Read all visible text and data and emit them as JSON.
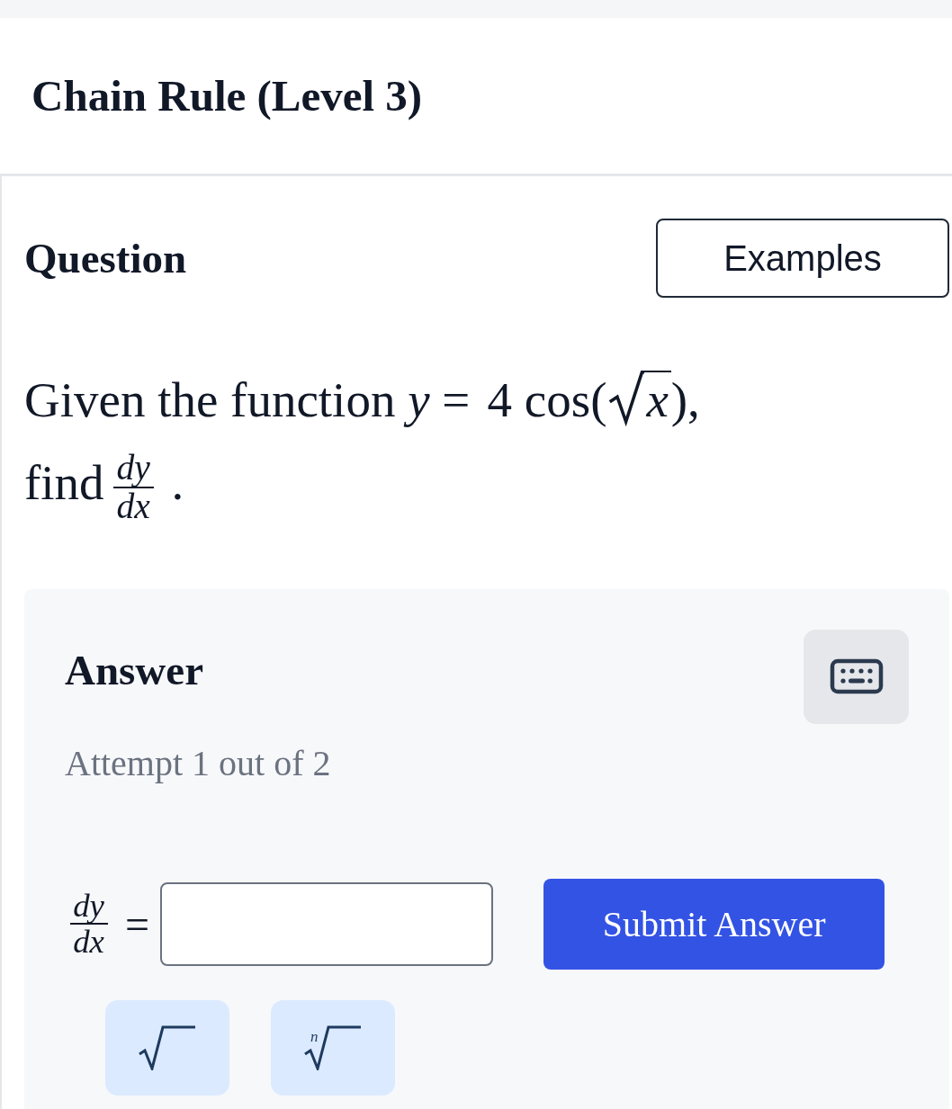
{
  "header": {
    "title": "Chain Rule (Level 3)"
  },
  "question": {
    "heading": "Question",
    "examples_button": "Examples",
    "prompt_lines": [
      [
        {
          "kind": "text",
          "text": "Given the function"
        },
        {
          "kind": "var",
          "text": "y"
        },
        {
          "kind": "op",
          "text": "="
        },
        {
          "kind": "text",
          "text": "4 cos("
        },
        {
          "kind": "sqrt",
          "text": "x"
        },
        {
          "kind": "text",
          "text": "),"
        }
      ],
      [
        {
          "kind": "text",
          "text": "find"
        },
        {
          "kind": "frac",
          "numerator": "dy",
          "denominator": "dx"
        },
        {
          "kind": "text",
          "text": "."
        }
      ]
    ]
  },
  "answer": {
    "heading": "Answer",
    "attempt": "Attempt 1 out of 2",
    "lhs": {
      "numerator": "dy",
      "denominator": "dx",
      "relation": "="
    },
    "submit_button": "Submit Answer",
    "math_buttons": [
      {
        "kind": "sqrt"
      },
      {
        "kind": "nthroot",
        "index": "n"
      }
    ]
  }
}
